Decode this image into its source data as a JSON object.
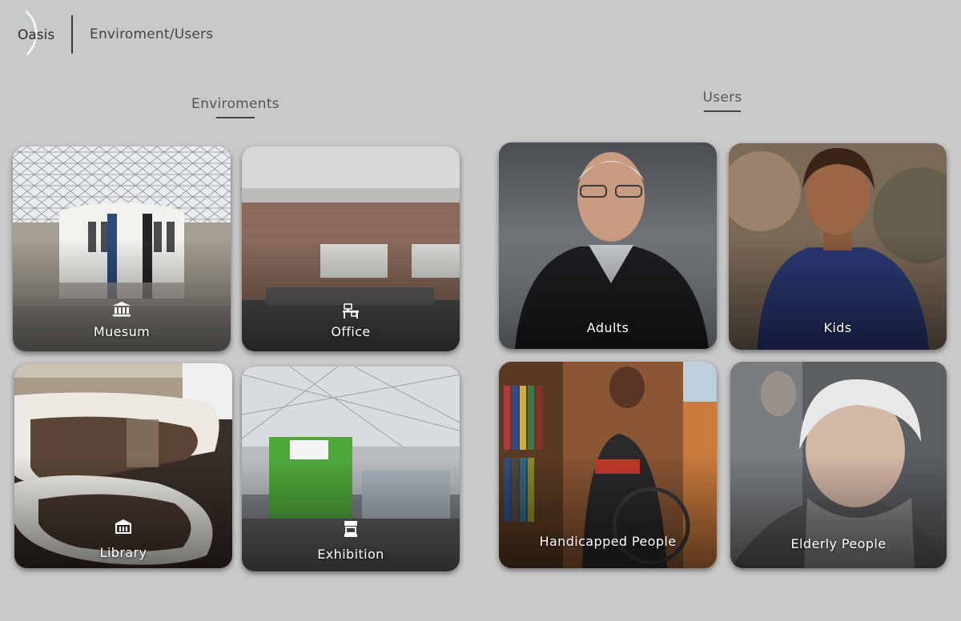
{
  "header": {
    "logo_text": "Oasis",
    "breadcrumb": "Enviroment/Users"
  },
  "environments": {
    "title": "Enviroments",
    "cards": [
      {
        "label": "Muesum",
        "icon": "museum-icon"
      },
      {
        "label": "Office",
        "icon": "office-desk-icon"
      },
      {
        "label": "Library",
        "icon": "library-icon"
      },
      {
        "label": "Exhibition",
        "icon": "exhibition-stand-icon"
      }
    ]
  },
  "users": {
    "title": "Users",
    "cards": [
      {
        "label": "Adults"
      },
      {
        "label": "Kids"
      },
      {
        "label": "Handicapped People"
      },
      {
        "label": "Elderly People"
      }
    ]
  }
}
